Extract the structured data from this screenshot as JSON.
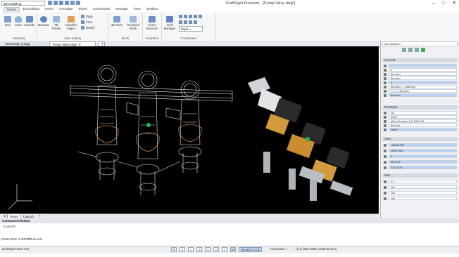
{
  "app": {
    "title": "DraftSight Premium - [Pump Valve.dwg*]",
    "workspace": "3D Modeling",
    "window_controls": [
      "–",
      "□",
      "✕"
    ]
  },
  "menu": {
    "tabs": [
      "Home",
      "3D Drafting",
      "Insert",
      "Annotate",
      "Sheet",
      "Constraints",
      "Manage",
      "View",
      "Toolbox"
    ],
    "active": "Home"
  },
  "ribbon": {
    "groups": {
      "modeling": "Modeling",
      "solid_editing": "Solid Editing",
      "mesh": "Mesh",
      "snapshot": "Snapshot",
      "coordinates": "Coordinates"
    },
    "buttons": {
      "box": "Box",
      "cone": "Cone",
      "extrude": "Extrude",
      "boolean": "Boolean",
      "rotate_3d": "3D Rotate",
      "chamfer_edges": "Chamfer edges",
      "edge": "Edge",
      "face": "Face",
      "modify": "Modify",
      "face_3d": "3D Face",
      "revolved_mesh": "Revolved Mesh",
      "cross_sections": "Cross Sections",
      "ccs_manager": "CCS Manager",
      "right": "Right"
    }
  },
  "doc_tabs": [
    "NONAME_0.dwg",
    "Pump Valve.dwg*"
  ],
  "active_doc": "Pump Valve.dwg*",
  "layout_tabs": [
    "Model",
    "Layout1"
  ],
  "palette": {
    "header": "No Selection",
    "sections": {
      "general": "General",
      "printstyle": "PrintStyle",
      "view": "View",
      "misc": "Misc"
    },
    "general_rows": [
      "",
      "0",
      "ByLayer",
      "ByLayer",
      "1",
      "ByLayer — Solid line",
      "——— ByLayer",
      "ByLayer"
    ],
    "printstyle_rows": [
      "No",
      "None",
      "MonoChrome (1:1) PRE US",
      "ByColor",
      "None"
    ],
    "view_rows": [
      "-14896.328",
      "-6991.906",
      "0",
      "967.422",
      "773.2425"
    ],
    "misc_rows": [
      "1:1",
      "Yes",
      "Yes",
      "Yes"
    ]
  },
  "command": {
    "header": "Command window",
    "lines": [
      "<Cancel>"
    ],
    "prompt": "Press ESC or ENTER to exit"
  },
  "status": {
    "version": "DraftSight 2019 x64",
    "dynamic_ccs": "Dynamic CCS",
    "annotation": "Annotation",
    "scale_coords": "(1:1)   (865.5909,14849.5244,0)"
  }
}
